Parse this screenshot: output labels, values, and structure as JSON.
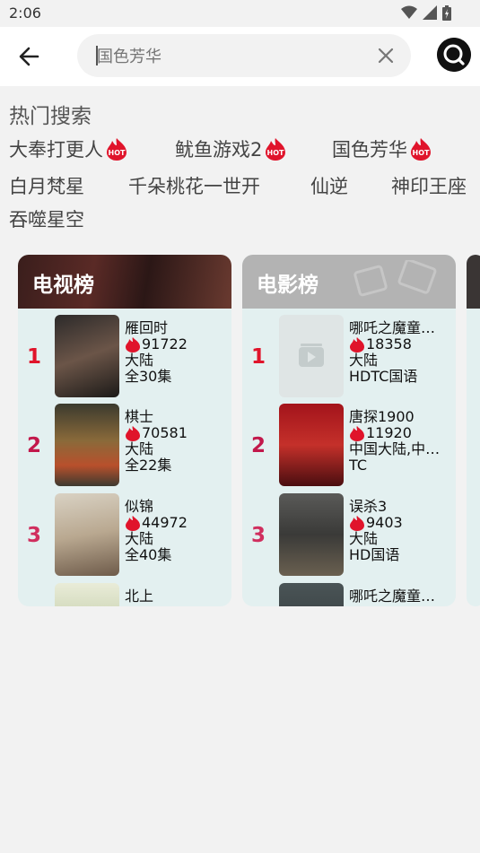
{
  "status_bar": {
    "time": "2:06"
  },
  "search": {
    "value": "",
    "placeholder": "国色芳华"
  },
  "hot": {
    "title": "热门搜索",
    "tags": [
      {
        "label": "大奉打更人",
        "hot": true
      },
      {
        "label": "鱿鱼游戏2",
        "hot": true
      },
      {
        "label": "国色芳华",
        "hot": true
      },
      {
        "label": "白月梵星",
        "hot": false
      },
      {
        "label": "千朵桃花一世开",
        "hot": false
      },
      {
        "label": "仙逆",
        "hot": false
      },
      {
        "label": "神印王座",
        "hot": false
      },
      {
        "label": "吞噬星空",
        "hot": false
      }
    ]
  },
  "tv": {
    "title": "电视榜",
    "items": [
      {
        "rank": "1",
        "name": "雁回时",
        "heat": "91722",
        "region": "大陆",
        "extra": "全30集"
      },
      {
        "rank": "2",
        "name": "棋士",
        "heat": "70581",
        "region": "大陆",
        "extra": "全22集"
      },
      {
        "rank": "3",
        "name": "似锦",
        "heat": "44972",
        "region": "大陆",
        "extra": "全40集"
      },
      {
        "rank": "",
        "name": "北上",
        "heat": "",
        "region": "",
        "extra": ""
      }
    ]
  },
  "movie": {
    "title": "电影榜",
    "items": [
      {
        "rank": "1",
        "name": "哪吒之魔童…",
        "heat": "18358",
        "region": "大陆",
        "extra": "HDTC国语"
      },
      {
        "rank": "2",
        "name": "唐探1900",
        "heat": "11920",
        "region": "中国大陆,中…",
        "extra": "TC"
      },
      {
        "rank": "3",
        "name": "误杀3",
        "heat": "9403",
        "region": "大陆",
        "extra": "HD国语"
      },
      {
        "rank": "",
        "name": "哪吒之魔童…",
        "heat": "",
        "region": "",
        "extra": ""
      }
    ]
  },
  "hot_badge_text": "HOT",
  "colors": {
    "rank1": "#e0142b",
    "rank2": "#c2184b",
    "rank3": "#d02e5e",
    "accent": "#111111"
  }
}
